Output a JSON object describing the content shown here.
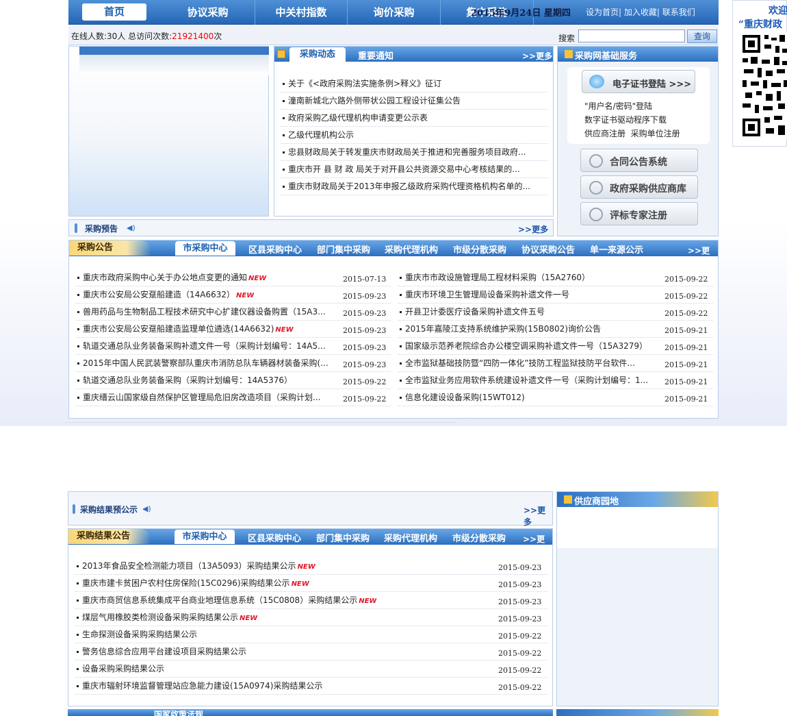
{
  "nav": {
    "items": [
      "首页",
      "协议采购",
      "中关村指数",
      "询价采购",
      "集中采购"
    ],
    "date": "2015年9月24日 星期四",
    "links": [
      "设为首页",
      "加入收藏",
      "联系我们"
    ]
  },
  "info": {
    "online_prefix": "在线人数:30人 总访问次数:",
    "visits": "21921400",
    "suffix": "次"
  },
  "search": {
    "label": "搜索",
    "button": "查询"
  },
  "news": {
    "tab_active": "采购动态",
    "tab2": "重要通知",
    "more": ">>更多",
    "items": [
      "关于《<政府采购法实施条例>释义》征订",
      "潼南新城北六路外侧带状公园工程设计征集公告",
      "政府采购乙级代理机构申请变更公示表",
      "乙级代理机构公示",
      "忠县财政局关于转发重庆市财政局关于推进和完善服务项目政府...",
      "重庆市开 县 财 政 局关于对开县公共资源交易中心考核结果的...",
      "重庆市财政局关于2013年申报乙级政府采购代理资格机构名单的..."
    ]
  },
  "service": {
    "title": "采购网基础服务",
    "cert_button": "电子证书登陆 >>>",
    "links": [
      "\"用户名/密码\"登陆",
      "数字证书驱动程序下载",
      "供应商注册",
      "采购单位注册"
    ],
    "buttons": [
      "合同公告系统",
      "政府采购供应商库",
      "评标专家注册"
    ]
  },
  "forecast": {
    "title": "采购预告",
    "more": ">>更多"
  },
  "notice": {
    "title": "采购公告",
    "tab_active": "市采购中心",
    "tabs": [
      "区县采购中心",
      "部门集中采购",
      "采购代理机构",
      "市级分散采购",
      "协议采购公告",
      "单一来源公示"
    ],
    "more": ">>更多",
    "left": [
      {
        "t": "重庆市政府采购中心关于办公地点变更的通知",
        "n": true,
        "d": "2015-07-13"
      },
      {
        "t": "重庆市公安局公安趸船建造（14A6632）",
        "n": true,
        "d": "2015-09-23"
      },
      {
        "t": "兽用药品与生物制品工程技术研究中心扩建仪器设备购置（15A3...",
        "n": false,
        "d": "2015-09-23"
      },
      {
        "t": "重庆市公安局公安趸船建造监理单位遴选(14A6632)",
        "n": true,
        "d": "2015-09-23"
      },
      {
        "t": "轨道交通总队业务装备采购补遗文件一号（采购计划编号：14A5...",
        "n": false,
        "d": "2015-09-23"
      },
      {
        "t": "2015年中国人民武装警察部队重庆市消防总队车辆器材装备采购(...",
        "n": false,
        "d": "2015-09-23"
      },
      {
        "t": "轨道交通总队业务装备采购（采购计划编号：14A5376）",
        "n": false,
        "d": "2015-09-22"
      },
      {
        "t": "重庆缙云山国家级自然保护区管理局危旧房改造项目（采购计划...",
        "n": false,
        "d": "2015-09-22"
      }
    ],
    "right": [
      {
        "t": "重庆市市政设施管理局工程材料采购（15A2760）",
        "d": "2015-09-22"
      },
      {
        "t": "重庆市环境卫生管理局设备采购补遗文件一号",
        "d": "2015-09-22"
      },
      {
        "t": "开县卫计委医疗设备采购补遗文件五号",
        "d": "2015-09-22"
      },
      {
        "t": "2015年嘉陵江支持系统维护采购(15B0802)询价公告",
        "d": "2015-09-21"
      },
      {
        "t": "国家级示范养老院综合办公楼空调采购补遗文件一号（15A3279）",
        "d": "2015-09-21"
      },
      {
        "t": "全市监狱基础技防暨“四防一体化”技防工程监狱技防平台软件...",
        "d": "2015-09-21"
      },
      {
        "t": "全市监狱业务应用软件系统建设补遗文件一号（采购计划编号：1...",
        "d": "2015-09-21"
      },
      {
        "t": "信息化建设设备采购(15WT012)",
        "d": "2015-09-21"
      }
    ]
  },
  "result_pre": {
    "title": "采购结果预公示",
    "more": ">>更多"
  },
  "supplier": {
    "title": "供应商园地"
  },
  "result": {
    "title": "采购结果公告",
    "tab_active": "市采购中心",
    "tabs": [
      "区县采购中心",
      "部门集中采购",
      "采购代理机构",
      "市级分散采购"
    ],
    "more": ">>更多",
    "items": [
      {
        "t": "2013年食品安全检测能力项目（13A5093）采购结果公示",
        "n": true,
        "d": "2015-09-23"
      },
      {
        "t": "重庆市建卡贫困户农村住房保险(15C0296)采购结果公示",
        "n": true,
        "d": "2015-09-23"
      },
      {
        "t": "重庆市商贸信息系统集成平台商业地理信息系统（15C0808）采购结果公示",
        "n": true,
        "d": "2015-09-23"
      },
      {
        "t": "煤层气用橡胶类检测设备采购采购结果公示",
        "n": true,
        "d": "2015-09-23"
      },
      {
        "t": "生命探测设备采购采购结果公示",
        "n": false,
        "d": "2015-09-22"
      },
      {
        "t": "警务信息综合应用平台建设项目采购结果公示",
        "n": false,
        "d": "2015-09-22"
      },
      {
        "t": "设备采购采购结果公示",
        "n": false,
        "d": "2015-09-22"
      },
      {
        "t": "重庆市辐射环境监督管理站应急能力建设(15A0974)采购结果公示",
        "n": false,
        "d": "2015-09-22"
      }
    ]
  },
  "bottom": {
    "tab2": "国家政策法规"
  },
  "welcome": {
    "line1": "欢迎",
    "line2": "“重庆财政"
  },
  "new_label": "NEW"
}
